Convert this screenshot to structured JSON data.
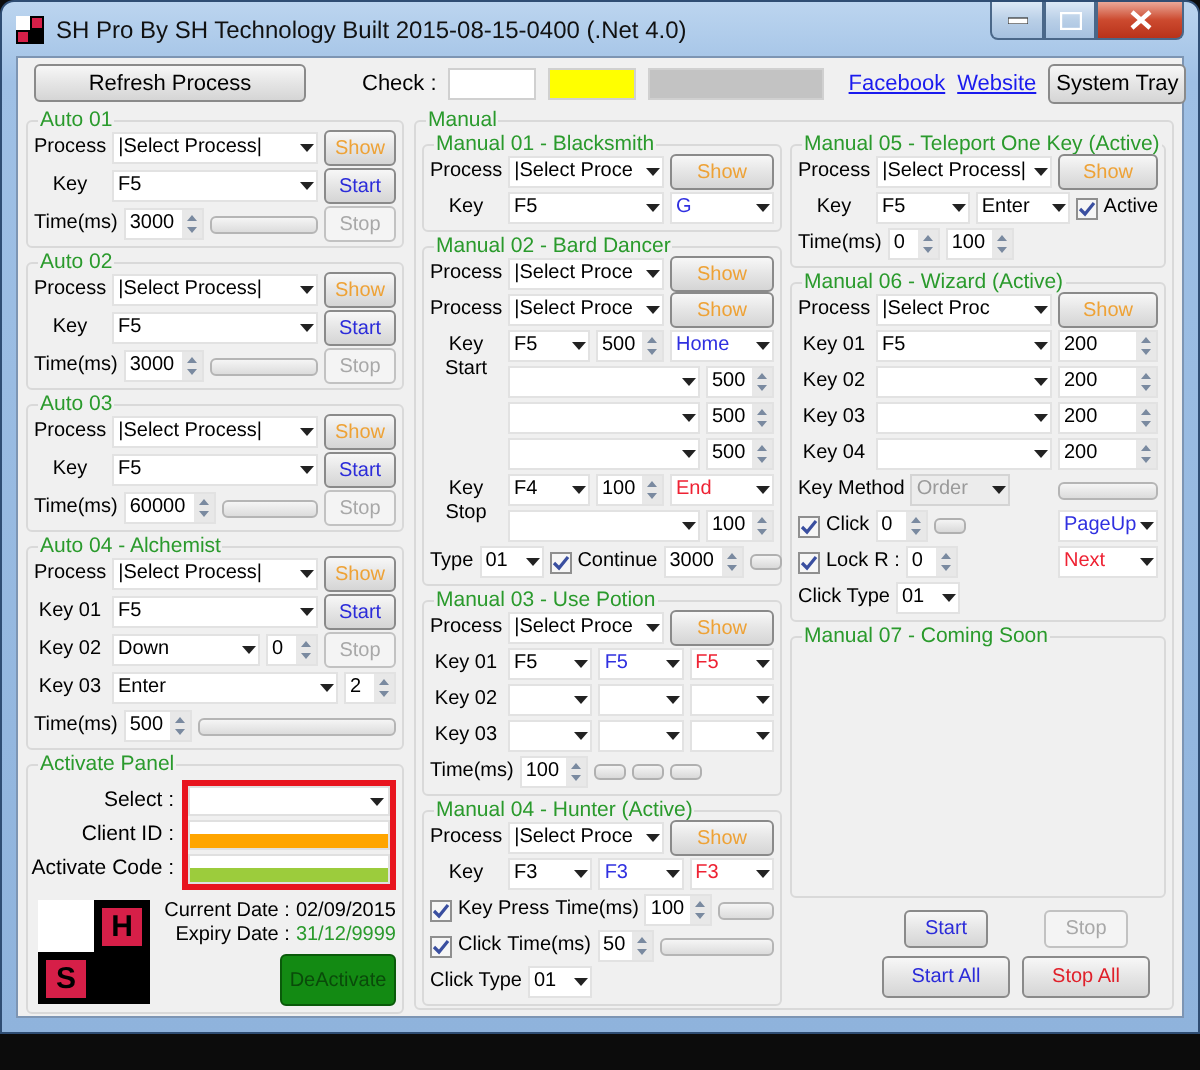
{
  "window": {
    "title": "SH Pro By SH Technology Built 2015-08-15-0400 (.Net 4.0)"
  },
  "toolbar": {
    "refresh_button": "Refresh Process",
    "check_label": "Check :",
    "check_indicators": [
      {
        "color": "#ffffff"
      },
      {
        "color": "#ffff00"
      },
      {
        "color": "#c3c3c3"
      }
    ],
    "links": [
      "Facebook",
      "Website"
    ],
    "tray_button": "System Tray"
  },
  "auto_groups": [
    {
      "title": "Auto 01",
      "rows": [
        {
          "kind": "field",
          "label": "Process",
          "items": [
            {
              "kind": "combo",
              "value": "|Select Process|"
            }
          ],
          "side": {
            "kind": "button",
            "label": "Show",
            "color": "#eea236",
            "disabled": false
          }
        },
        {
          "kind": "field",
          "label": "Key",
          "items": [
            {
              "kind": "combo",
              "value": "F5"
            }
          ],
          "side": {
            "kind": "button",
            "label": "Start",
            "color": "#2b2bd9",
            "disabled": false
          }
        },
        {
          "kind": "field",
          "label": "Time(ms)",
          "items": [
            {
              "kind": "spin",
              "value": "3000"
            },
            {
              "kind": "bar",
              "level": 0
            }
          ],
          "side": {
            "kind": "button",
            "label": "Stop",
            "disabled": true
          }
        }
      ]
    },
    {
      "title": "Auto 02",
      "rows": [
        {
          "kind": "field",
          "label": "Process",
          "items": [
            {
              "kind": "combo",
              "value": "|Select Process|"
            }
          ],
          "side": {
            "kind": "button",
            "label": "Show",
            "color": "#eea236",
            "disabled": false
          }
        },
        {
          "kind": "field",
          "label": "Key",
          "items": [
            {
              "kind": "combo",
              "value": "F5"
            }
          ],
          "side": {
            "kind": "button",
            "label": "Start",
            "color": "#2b2bd9",
            "disabled": false
          }
        },
        {
          "kind": "field",
          "label": "Time(ms)",
          "items": [
            {
              "kind": "spin",
              "value": "3000"
            },
            {
              "kind": "bar",
              "level": 0
            }
          ],
          "side": {
            "kind": "button",
            "label": "Stop",
            "disabled": true
          }
        }
      ]
    },
    {
      "title": "Auto 03",
      "rows": [
        {
          "kind": "field",
          "label": "Process",
          "items": [
            {
              "kind": "combo",
              "value": "|Select Process|"
            }
          ],
          "side": {
            "kind": "button",
            "label": "Show",
            "color": "#eea236",
            "disabled": false
          }
        },
        {
          "kind": "field",
          "label": "Key",
          "items": [
            {
              "kind": "combo",
              "value": "F5"
            }
          ],
          "side": {
            "kind": "button",
            "label": "Start",
            "color": "#2b2bd9",
            "disabled": false
          }
        },
        {
          "kind": "field",
          "label": "Time(ms)",
          "items": [
            {
              "kind": "spin",
              "value": "60000"
            },
            {
              "kind": "bar",
              "level": 0
            }
          ],
          "side": {
            "kind": "button",
            "label": "Stop",
            "disabled": true
          }
        }
      ]
    },
    {
      "title": "Auto 04 - Alchemist",
      "rows": [
        {
          "kind": "field",
          "label": "Process",
          "items": [
            {
              "kind": "combo",
              "value": "|Select Process|"
            }
          ],
          "side": {
            "kind": "button",
            "label": "Show",
            "color": "#eea236",
            "disabled": false
          }
        },
        {
          "kind": "field",
          "label": "Key 01",
          "items": [
            {
              "kind": "combo",
              "value": "F5"
            }
          ],
          "side": {
            "kind": "button",
            "label": "Start",
            "color": "#2b2bd9",
            "disabled": false
          }
        },
        {
          "kind": "field",
          "label": "Key 02",
          "items": [
            {
              "kind": "combo",
              "value": "Down"
            },
            {
              "kind": "spin",
              "value": "0"
            }
          ],
          "side": {
            "kind": "button",
            "label": "Stop",
            "disabled": true
          }
        },
        {
          "kind": "field",
          "label": "Key 03",
          "items": [
            {
              "kind": "combo",
              "value": "Enter"
            },
            {
              "kind": "spin",
              "value": "2"
            }
          ]
        },
        {
          "kind": "field",
          "label": "Time(ms)",
          "items": [
            {
              "kind": "spin",
              "value": "500"
            },
            {
              "kind": "bar",
              "level": 0
            }
          ]
        }
      ]
    }
  ],
  "activate_panel": {
    "title": "Activate Panel",
    "highlight_frame": true,
    "fields": [
      {
        "label": "Select :",
        "kind": "combo",
        "color": "#ffffff"
      },
      {
        "label": "Client ID :",
        "kind": "input",
        "color": "#ffa500"
      },
      {
        "label": "Activate Code :",
        "kind": "input",
        "color": "#9ccc3c"
      }
    ],
    "logo": {
      "letters": [
        "H",
        "S"
      ]
    },
    "dates": [
      {
        "label": "Current Date :",
        "value": "02/09/2015",
        "color": "#000000"
      },
      {
        "label": "Expiry Date :",
        "value": "31/12/9999",
        "color": "#2a9a2c"
      }
    ],
    "button": "DeActivate"
  },
  "manual": {
    "title": "Manual",
    "columns": [
      {
        "groups": [
          {
            "title": "Manual 01 - Blacksmith",
            "rows": [
              {
                "kind": "field",
                "label": "Process",
                "items": [
                  {
                    "kind": "combo",
                    "value": "|Select Proce"
                  }
                ],
                "side": {
                  "kind": "button",
                  "label": "Show",
                  "color": "#eea236",
                  "disabled": false
                }
              },
              {
                "kind": "field",
                "label": "Key",
                "items": [
                  {
                    "kind": "combo",
                    "value": "F5"
                  }
                ],
                "side": {
                  "kind": "combo",
                  "value": "G",
                  "color": "#3030e0"
                }
              }
            ]
          },
          {
            "title": "Manual 02 - Bard Dancer",
            "rows": [
              {
                "kind": "field",
                "label": "Process",
                "items": [
                  {
                    "kind": "combo",
                    "value": "|Select Proce"
                  }
                ],
                "side": {
                  "kind": "button",
                  "label": "Show",
                  "color": "#eea236",
                  "disabled": false
                }
              },
              {
                "kind": "field",
                "label": "Process",
                "items": [
                  {
                    "kind": "combo",
                    "value": "|Select Proce"
                  }
                ],
                "side": {
                  "kind": "button",
                  "label": "Show",
                  "color": "#eea236",
                  "disabled": false
                }
              },
              {
                "kind": "field",
                "label": "Key Start",
                "items": [
                  {
                    "kind": "combo",
                    "value": "F5"
                  },
                  {
                    "kind": "spin",
                    "value": "500"
                  }
                ],
                "side": {
                  "kind": "combo",
                  "value": "Home",
                  "color": "#3030e0"
                }
              },
              {
                "kind": "field",
                "items": [
                  {
                    "kind": "combo"
                  },
                  {
                    "kind": "spin",
                    "value": "500"
                  }
                ]
              },
              {
                "kind": "field",
                "items": [
                  {
                    "kind": "combo"
                  },
                  {
                    "kind": "spin",
                    "value": "500"
                  }
                ]
              },
              {
                "kind": "field",
                "items": [
                  {
                    "kind": "combo"
                  },
                  {
                    "kind": "spin",
                    "value": "500"
                  }
                ]
              },
              {
                "kind": "field",
                "label": "Key Stop",
                "items": [
                  {
                    "kind": "combo",
                    "value": "F4"
                  },
                  {
                    "kind": "spin",
                    "value": "100"
                  }
                ],
                "side": {
                  "kind": "combo",
                  "value": "End",
                  "color": "#ee2233"
                }
              },
              {
                "kind": "field",
                "items": [
                  {
                    "kind": "combo"
                  },
                  {
                    "kind": "spin",
                    "value": "100"
                  }
                ]
              },
              {
                "kind": "free",
                "items": [
                  {
                    "kind": "text",
                    "text": "Type"
                  },
                  {
                    "kind": "combo",
                    "value": "01"
                  },
                  {
                    "kind": "check",
                    "label": "Continue",
                    "checked": true
                  },
                  {
                    "kind": "spin",
                    "value": "3000"
                  },
                  {
                    "kind": "mini"
                  }
                ]
              }
            ]
          },
          {
            "title": "Manual 03 - Use Potion",
            "rows": [
              {
                "kind": "field",
                "label": "Process",
                "items": [
                  {
                    "kind": "combo",
                    "value": "|Select Proce"
                  }
                ],
                "side": {
                  "kind": "button",
                  "label": "Show",
                  "color": "#eea236",
                  "disabled": false
                }
              },
              {
                "kind": "field",
                "label": "Key 01",
                "items": [
                  {
                    "kind": "combo",
                    "value": "F5"
                  },
                  {
                    "kind": "combo",
                    "value": "F5",
                    "color": "#3030e0"
                  },
                  {
                    "kind": "combo",
                    "value": "F5",
                    "color": "#ee2233"
                  }
                ]
              },
              {
                "kind": "field",
                "label": "Key 02",
                "items": [
                  {
                    "kind": "combo"
                  },
                  {
                    "kind": "combo"
                  },
                  {
                    "kind": "combo"
                  }
                ]
              },
              {
                "kind": "field",
                "label": "Key 03",
                "items": [
                  {
                    "kind": "combo"
                  },
                  {
                    "kind": "combo"
                  },
                  {
                    "kind": "combo"
                  }
                ]
              },
              {
                "kind": "field",
                "label": "Time(ms)",
                "items": [
                  {
                    "kind": "spin",
                    "value": "100"
                  },
                  {
                    "kind": "mini"
                  },
                  {
                    "kind": "mini"
                  },
                  {
                    "kind": "mini"
                  }
                ]
              }
            ]
          },
          {
            "title": "Manual 04 - Hunter (Active)",
            "rows": [
              {
                "kind": "field",
                "label": "Process",
                "items": [
                  {
                    "kind": "combo",
                    "value": "|Select Proce"
                  }
                ],
                "side": {
                  "kind": "button",
                  "label": "Show",
                  "color": "#eea236",
                  "disabled": false
                }
              },
              {
                "kind": "field",
                "label": "Key",
                "items": [
                  {
                    "kind": "combo",
                    "value": "F3"
                  },
                  {
                    "kind": "combo",
                    "value": "F3",
                    "color": "#3030e0"
                  },
                  {
                    "kind": "combo",
                    "value": "F3",
                    "color": "#ee2233"
                  }
                ]
              },
              {
                "kind": "free",
                "items": [
                  {
                    "kind": "check",
                    "label": "Key Press",
                    "checked": true
                  },
                  {
                    "kind": "text",
                    "text": "Time(ms)"
                  },
                  {
                    "kind": "spin",
                    "value": "100"
                  },
                  {
                    "kind": "bar",
                    "level": 0
                  }
                ]
              },
              {
                "kind": "free",
                "items": [
                  {
                    "kind": "check",
                    "label": "Click",
                    "checked": true
                  },
                  {
                    "kind": "text",
                    "text": "Time(ms)"
                  },
                  {
                    "kind": "spin",
                    "value": "50"
                  },
                  {
                    "kind": "bar",
                    "level": 0
                  }
                ]
              },
              {
                "kind": "free",
                "items": [
                  {
                    "kind": "text",
                    "text": "Click Type"
                  },
                  {
                    "kind": "combo",
                    "value": "01"
                  }
                ]
              }
            ]
          }
        ]
      },
      {
        "groups": [
          {
            "title": "Manual 05 - Teleport One Key (Active)",
            "rows": [
              {
                "kind": "field",
                "label": "Process",
                "items": [
                  {
                    "kind": "combo",
                    "value": "|Select Process|"
                  }
                ],
                "side": {
                  "kind": "button",
                  "label": "Show",
                  "color": "#eea236",
                  "disabled": false
                }
              },
              {
                "kind": "field",
                "label": "Key",
                "items": [
                  {
                    "kind": "combo",
                    "value": "F5"
                  },
                  {
                    "kind": "combo",
                    "value": "Enter"
                  },
                  {
                    "kind": "check",
                    "label": "Active",
                    "checked": true
                  }
                ]
              },
              {
                "kind": "field",
                "label": "Time(ms)",
                "items": [
                  {
                    "kind": "spin",
                    "value": "0"
                  },
                  {
                    "kind": "spin",
                    "value": "100"
                  }
                ]
              }
            ]
          },
          {
            "title": "Manual 06 - Wizard (Active)",
            "rows": [
              {
                "kind": "field",
                "label": "Process",
                "items": [
                  {
                    "kind": "combo",
                    "value": "|Select Proc"
                  }
                ],
                "side": {
                  "kind": "button",
                  "label": "Show",
                  "color": "#eea236",
                  "disabled": false
                }
              },
              {
                "kind": "field",
                "label": "Key 01",
                "items": [
                  {
                    "kind": "combo",
                    "value": "F5"
                  }
                ],
                "side": {
                  "kind": "spin",
                  "value": "200"
                }
              },
              {
                "kind": "field",
                "label": "Key 02",
                "items": [
                  {
                    "kind": "combo"
                  }
                ],
                "side": {
                  "kind": "spin",
                  "value": "200"
                }
              },
              {
                "kind": "field",
                "label": "Key 03",
                "items": [
                  {
                    "kind": "combo"
                  }
                ],
                "side": {
                  "kind": "spin",
                  "value": "200"
                }
              },
              {
                "kind": "field",
                "label": "Key 04",
                "items": [
                  {
                    "kind": "combo"
                  }
                ],
                "side": {
                  "kind": "spin",
                  "value": "200"
                }
              },
              {
                "kind": "free",
                "items": [
                  {
                    "kind": "text",
                    "text": "Key Method"
                  },
                  {
                    "kind": "combo",
                    "value": "Order",
                    "disabled": true
                  }
                ],
                "side": {
                  "kind": "bar",
                  "level": 0
                }
              },
              {
                "kind": "free",
                "items": [
                  {
                    "kind": "check",
                    "label": "Click",
                    "checked": true
                  },
                  {
                    "kind": "spin",
                    "value": "0"
                  },
                  {
                    "kind": "mini"
                  }
                ],
                "side": {
                  "kind": "combo",
                  "value": "PageUp",
                  "color": "#3030e0"
                }
              },
              {
                "kind": "free",
                "items": [
                  {
                    "kind": "check",
                    "label": "Lock",
                    "checked": true
                  },
                  {
                    "kind": "text",
                    "text": "R :"
                  },
                  {
                    "kind": "spin",
                    "value": "0"
                  }
                ],
                "side": {
                  "kind": "combo",
                  "value": "Next",
                  "color": "#ee2233"
                }
              },
              {
                "kind": "free",
                "items": [
                  {
                    "kind": "text",
                    "text": "Click Type"
                  },
                  {
                    "kind": "combo",
                    "value": "01"
                  }
                ]
              }
            ]
          },
          {
            "title": "Manual 07 - Coming Soon"
          }
        ]
      }
    ],
    "footer_rows": [
      {
        "buttons": [
          {
            "label": "Start",
            "color": "#2b2bd9",
            "disabled": false
          },
          {
            "label": "Stop",
            "disabled": true
          }
        ]
      },
      {
        "buttons": [
          {
            "label": "Start All",
            "color": "#2b2bd9",
            "disabled": false
          },
          {
            "label": "Stop All",
            "color": "#e0202a",
            "disabled": false
          }
        ]
      }
    ]
  }
}
